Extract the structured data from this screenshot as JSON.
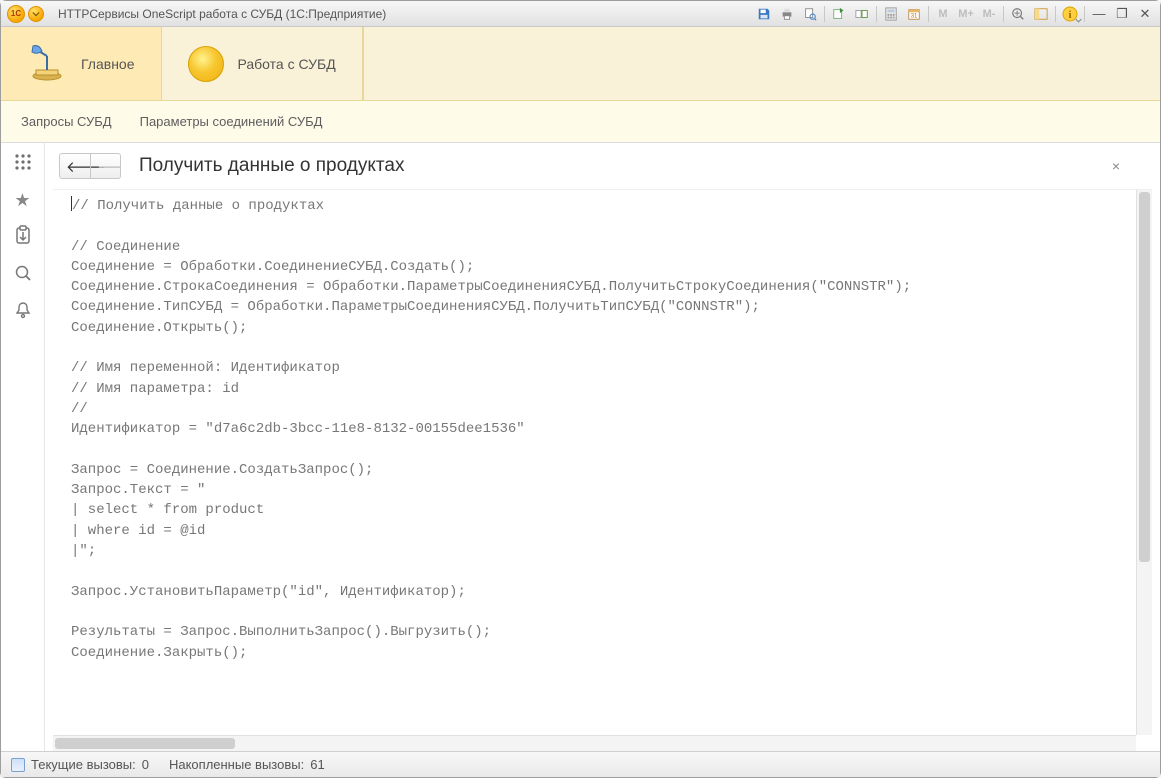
{
  "title": "HTTPСервисы OneScript работа с СУБД  (1С:Предприятие)",
  "logo_text": "1C",
  "toolbar_icons": {
    "save": "save-icon",
    "print": "print-icon",
    "print_preview": "print-preview-icon",
    "goto": "goto-icon",
    "compare": "compare-icon",
    "calculator": "calculator-icon",
    "calendar": "calendar-icon",
    "m": "M",
    "m_plus": "M+",
    "m_minus": "M-",
    "zoom_in": "zoom-in-icon",
    "panels": "panels-icon",
    "help": "help-icon"
  },
  "window_controls": {
    "minimize": "—",
    "restore": "❐",
    "close": "✕"
  },
  "section_tabs": [
    {
      "label": "Главное",
      "active": true
    },
    {
      "label": "Работа с СУБД",
      "active": false
    }
  ],
  "subnav": {
    "queries": "Запросы СУБД",
    "conn_params": "Параметры соединений СУБД"
  },
  "left_rail": {
    "grid": "grid-icon",
    "star": "star-icon",
    "clipboard": "clipboard-icon",
    "search": "search-icon",
    "bell": "bell-icon"
  },
  "page": {
    "title": "Получить данные о продуктах",
    "close": "×"
  },
  "code_lines": [
    "// Получить данные о продуктах",
    "",
    "// Соединение",
    "Соединение = Обработки.СоединениеСУБД.Создать();",
    "Соединение.СтрокаСоединения = Обработки.ПараметрыСоединенияСУБД.ПолучитьСтрокуСоединения(\"CONNSTR\");",
    "Соединение.ТипСУБД = Обработки.ПараметрыСоединенияСУБД.ПолучитьТипСУБД(\"CONNSTR\");",
    "Соединение.Открыть();",
    "",
    "// Имя переменной: Идентификатор",
    "// Имя параметра: id",
    "//",
    "Идентификатор = \"d7a6c2db-3bcc-11e8-8132-00155dee1536\"",
    "",
    "Запрос = Соединение.СоздатьЗапрос();",
    "Запрос.Текст = \"",
    "| select * from product",
    "| where id = @id",
    "|\";",
    "",
    "Запрос.УстановитьПараметр(\"id\", Идентификатор);",
    "",
    "Результаты = Запрос.ВыполнитьЗапрос().Выгрузить();",
    "Соединение.Закрыть();"
  ],
  "status": {
    "current_calls_label": "Текущие вызовы:",
    "current_calls_value": "0",
    "accumulated_calls_label": "Накопленные вызовы:",
    "accumulated_calls_value": "61"
  }
}
